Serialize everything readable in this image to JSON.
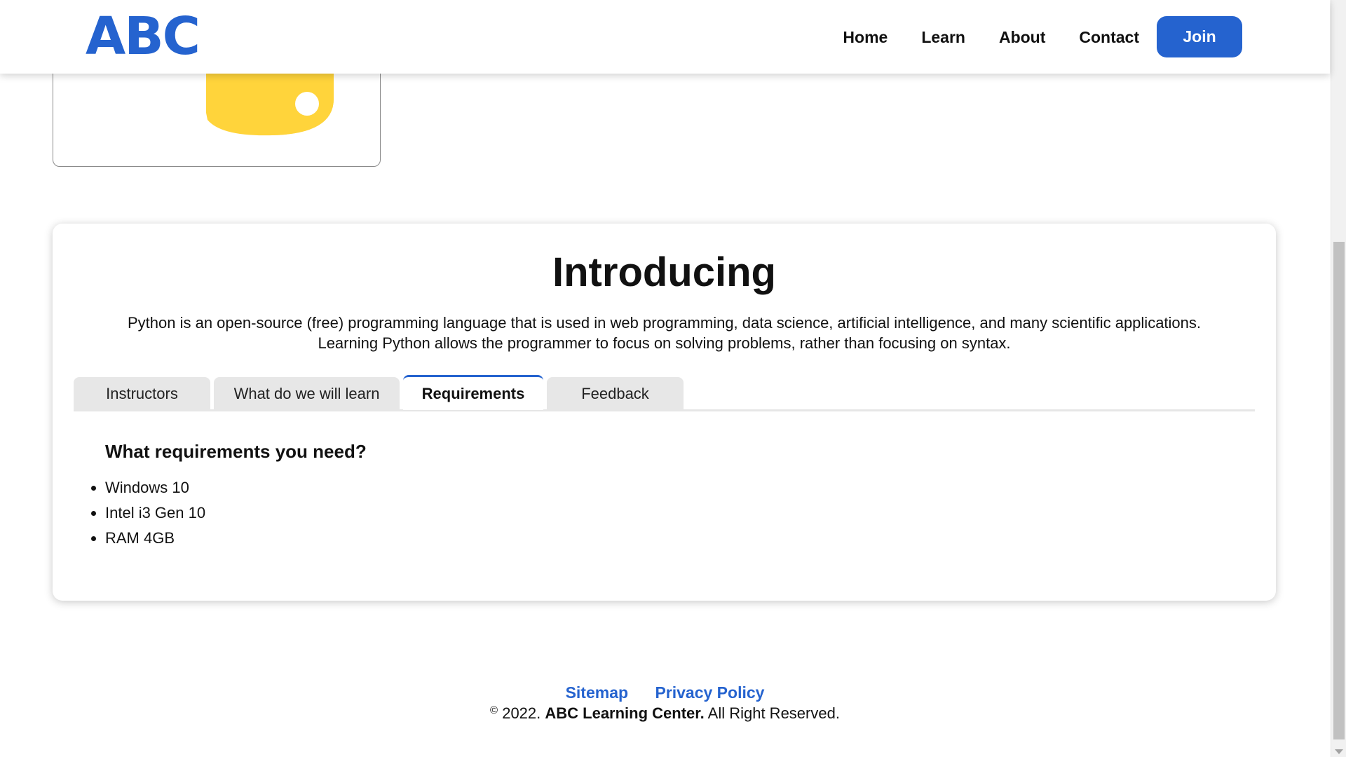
{
  "header": {
    "brand": "ABC",
    "nav": [
      "Home",
      "Learn",
      "About",
      "Contact"
    ],
    "join_label": "Join"
  },
  "intro": {
    "title": "Introducing",
    "description_line1": "Python is an open-source (free) programming language that is used in web programming, data science, artificial intelligence, and many scientific applications.",
    "description_line2": "Learning Python allows the programmer to focus on solving problems, rather than focusing on syntax."
  },
  "tabs": [
    "Instructors",
    "What do we will learn",
    "Requirements",
    "Feedback"
  ],
  "active_tab": "Requirements",
  "requirements": {
    "heading": "What requirements you need?",
    "items": [
      "Windows 10",
      "Intel i3 Gen 10",
      "RAM 4GB"
    ]
  },
  "footer": {
    "links": [
      "Sitemap",
      "Privacy Policy"
    ],
    "copyright_symbol": "©",
    "copyright_year": " 2022. ",
    "copyright_org": "ABC Learning Center.",
    "copyright_suffix": " All Right Reserved."
  },
  "colors": {
    "accent": "#2563cf",
    "python_yellow": "#ffd43b"
  },
  "icons": {
    "logo_image": "python-logo-icon"
  }
}
